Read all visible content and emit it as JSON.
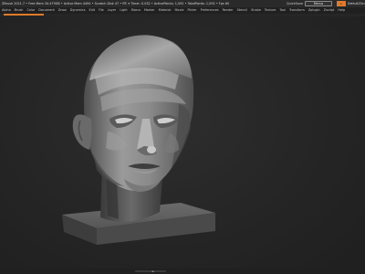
{
  "titlebar": {
    "title": "ZBrush 2021.7 • Free Mem 34.479GB • Active Mem 4494 • Scratch Disk 47 • RT: ▾ Timer: 0.032 • ActivePoints: 1,092 • TotalPoints: 1,092 • Fps 60",
    "quicksave_label": "QuickSave",
    "menus_label": "Menus",
    "preset_label": "DefaultZScript",
    "default_label": "DefaultZScript"
  },
  "menubar": {
    "items": [
      "Alpha",
      "Brush",
      "Color",
      "Document",
      "Draw",
      "Dynamics",
      "Edit",
      "File",
      "Layer",
      "Light",
      "Macro",
      "Marker",
      "Material",
      "Movie",
      "Picker",
      "Preferences",
      "Render",
      "Stencil",
      "Stroke",
      "Texture",
      "Tool",
      "Transform",
      "Zplugin",
      "Zscript",
      "Help"
    ]
  },
  "progress": {
    "value_percent": 11
  },
  "viewport": {
    "model": "head-sculpt",
    "background_color": "#262626",
    "model_color": "#8e8e8e"
  },
  "icons": {
    "navigation": "navigation-gizmo-icon"
  },
  "colors": {
    "accent": "#e07a2a",
    "panel": "#202020"
  }
}
